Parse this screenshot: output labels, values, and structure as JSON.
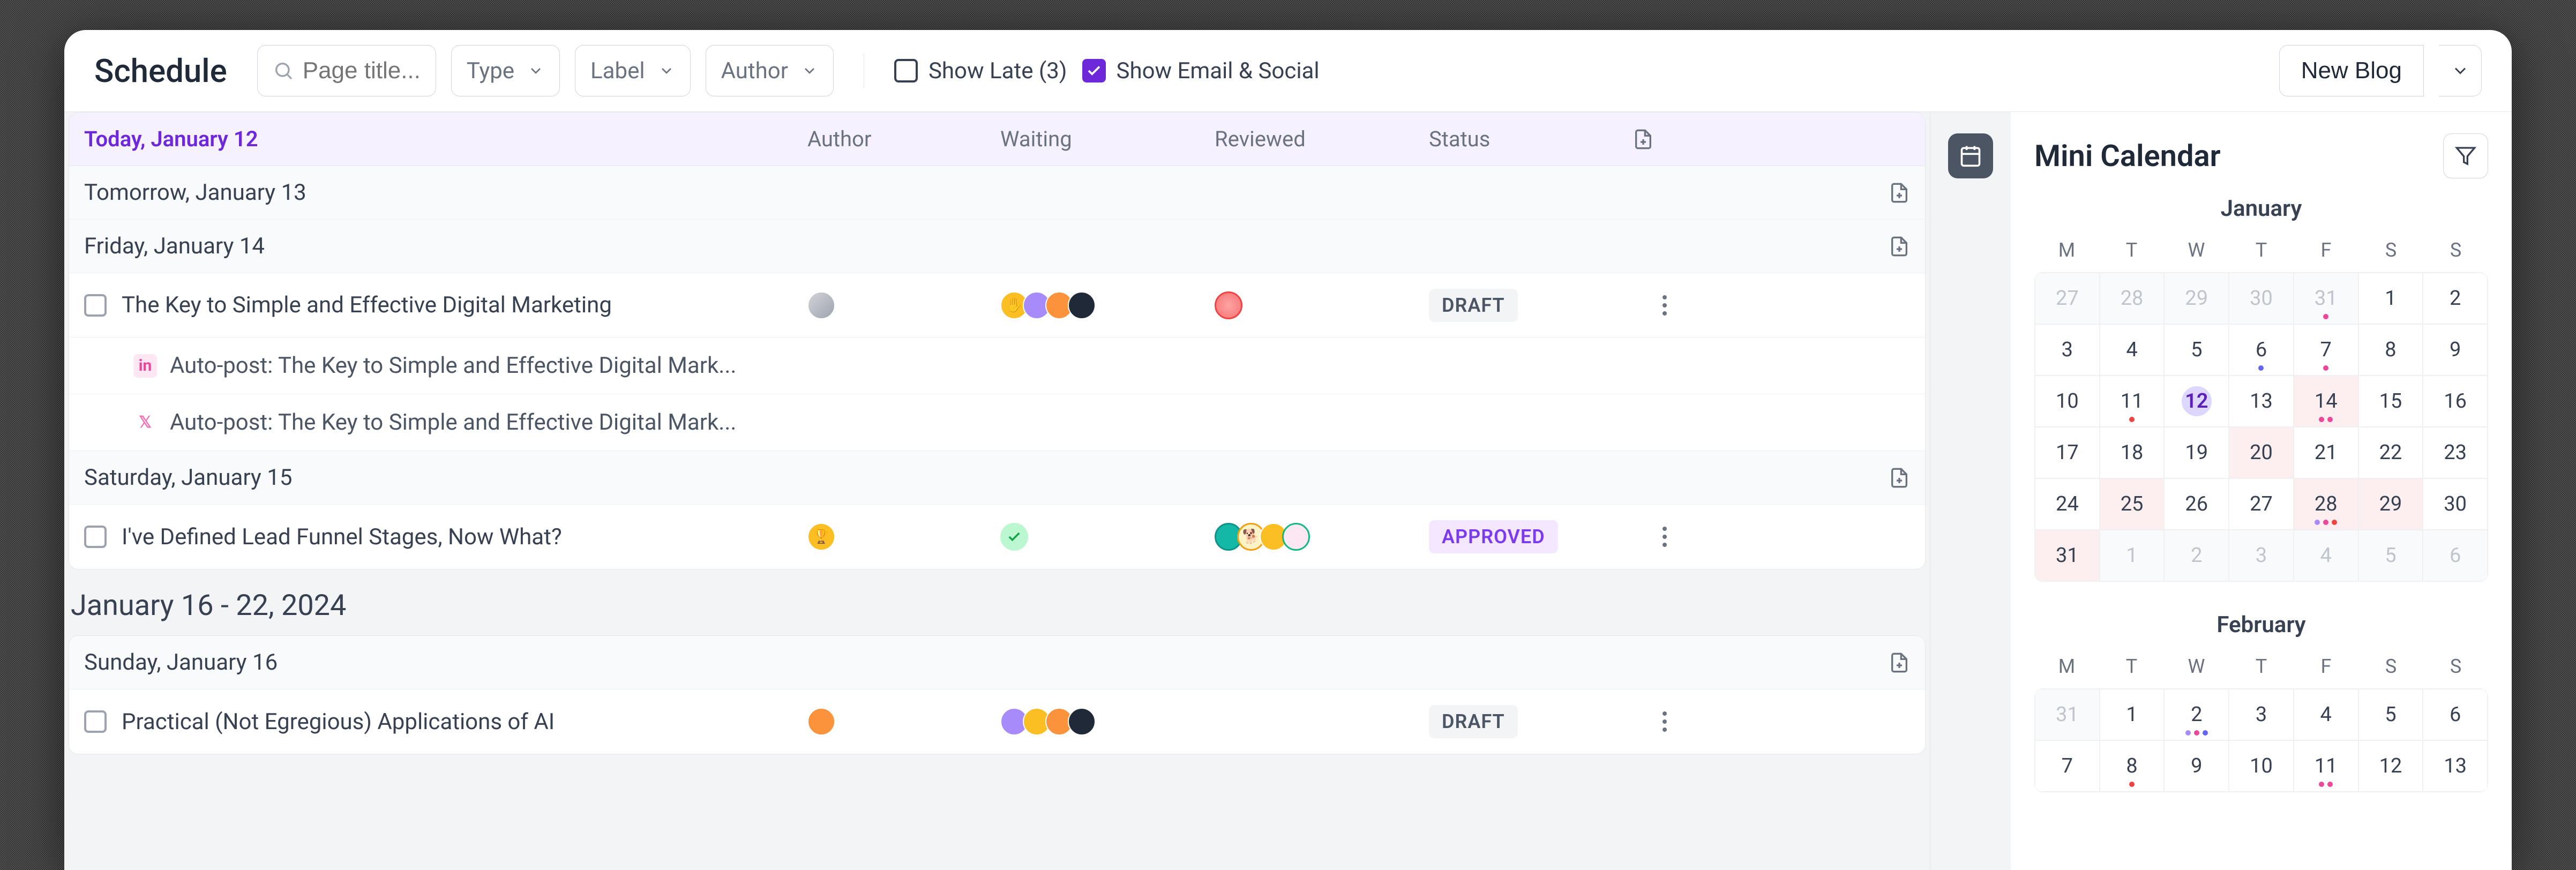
{
  "header": {
    "title": "Schedule",
    "search_placeholder": "Page title...",
    "filters": {
      "type": "Type",
      "label": "Label",
      "author": "Author"
    },
    "show_late": "Show Late (3)",
    "show_email_social": "Show Email & Social",
    "new_blog": "New Blog"
  },
  "sidebar": {
    "title": "Mini Calendar",
    "dow": [
      "M",
      "T",
      "W",
      "T",
      "F",
      "S",
      "S"
    ],
    "months": [
      {
        "name": "January",
        "cells": [
          {
            "n": 27,
            "out": true
          },
          {
            "n": 28,
            "out": true
          },
          {
            "n": 29,
            "out": true
          },
          {
            "n": 30,
            "out": true
          },
          {
            "n": 31,
            "out": true,
            "dots": [
              "#ec4899"
            ]
          },
          {
            "n": 1
          },
          {
            "n": 2
          },
          {
            "n": 3
          },
          {
            "n": 4
          },
          {
            "n": 5
          },
          {
            "n": 6,
            "dots": [
              "#6366f1"
            ]
          },
          {
            "n": 7,
            "dots": [
              "#ec4899"
            ]
          },
          {
            "n": 8
          },
          {
            "n": 9
          },
          {
            "n": 10
          },
          {
            "n": 11,
            "dots": [
              "#ef4444"
            ]
          },
          {
            "n": 12,
            "today": true
          },
          {
            "n": 13
          },
          {
            "n": 14,
            "hl": true,
            "dots": [
              "#ec4899",
              "#ec4899"
            ]
          },
          {
            "n": 15
          },
          {
            "n": 16
          },
          {
            "n": 17
          },
          {
            "n": 18
          },
          {
            "n": 19
          },
          {
            "n": 20,
            "hl": true
          },
          {
            "n": 21
          },
          {
            "n": 22
          },
          {
            "n": 23
          },
          {
            "n": 24
          },
          {
            "n": 25,
            "hl": true
          },
          {
            "n": 26
          },
          {
            "n": 27
          },
          {
            "n": 28,
            "hl": true,
            "dots": [
              "#a78bfa",
              "#ec4899",
              "#ef4444"
            ]
          },
          {
            "n": 29,
            "hl": true
          },
          {
            "n": 30
          },
          {
            "n": 31,
            "hl": true
          },
          {
            "n": 1,
            "out": true
          },
          {
            "n": 2,
            "out": true
          },
          {
            "n": 3,
            "out": true
          },
          {
            "n": 4,
            "out": true
          },
          {
            "n": 5,
            "out": true
          },
          {
            "n": 6,
            "out": true
          }
        ]
      },
      {
        "name": "February",
        "cells": [
          {
            "n": 31,
            "out": true
          },
          {
            "n": 1
          },
          {
            "n": 2,
            "dots": [
              "#a78bfa",
              "#ec4899",
              "#6366f1"
            ]
          },
          {
            "n": 3
          },
          {
            "n": 4
          },
          {
            "n": 5
          },
          {
            "n": 6
          },
          {
            "n": 7
          },
          {
            "n": 8,
            "dots": [
              "#ef4444"
            ]
          },
          {
            "n": 9
          },
          {
            "n": 10
          },
          {
            "n": 11,
            "dots": [
              "#ec4899",
              "#ec4899"
            ]
          },
          {
            "n": 12
          },
          {
            "n": 13
          }
        ]
      }
    ]
  },
  "columns": {
    "c1": "Today, January 12",
    "author": "Author",
    "waiting": "Waiting",
    "reviewed": "Reviewed",
    "status": "Status"
  },
  "days": {
    "tomorrow": "Tomorrow, January 13",
    "friday": "Friday, January 14",
    "saturday": "Saturday, January 15",
    "sunday": "Sunday, January 16"
  },
  "week2": "January 16 - 22, 2024",
  "items": {
    "i1": {
      "title": "The Key to Simple and Effective Digital Marketing",
      "status": "DRAFT",
      "sub1": "Auto-post: The Key to Simple and Effective Digital Mark...",
      "sub2": "Auto-post: The Key to Simple and Effective Digital Mark..."
    },
    "i2": {
      "title": "I've Defined Lead Funnel Stages, Now What?",
      "status": "APPROVED"
    },
    "i3": {
      "title": "Practical (Not Egregious) Applications of AI",
      "status": "DRAFT"
    }
  }
}
